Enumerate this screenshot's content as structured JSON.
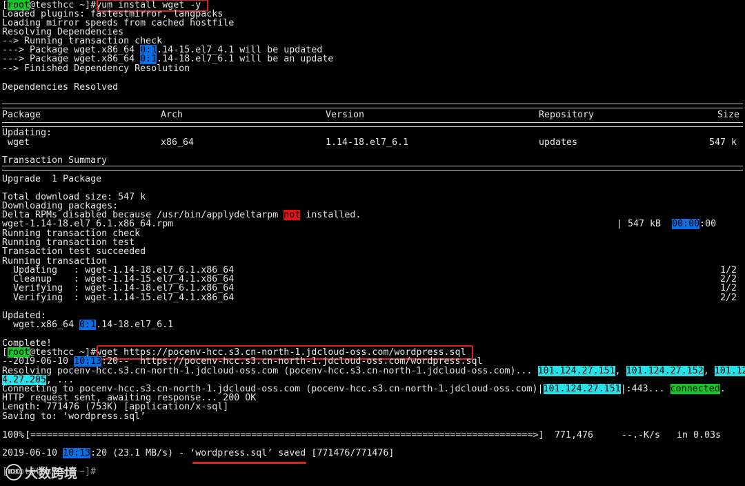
{
  "colors": {
    "prompt_highlight": "#18c428",
    "time_highlight": "#0a6fe6",
    "error_highlight": "#e01414",
    "ip_highlight": "#28e0e8",
    "annotation": "#e0241c"
  },
  "prompt": {
    "user": "root",
    "host": "@testhcc ~]#",
    "open": "["
  },
  "cmd1": "yum install wget -y",
  "lines1": [
    "Loaded plugins: fastestmirror, langpacks",
    "Loading mirror speeds from cached hostfile",
    "Resolving Dependencies",
    "--> Running transaction check"
  ],
  "pkg_line1": {
    "pre": "---> Package wget.x86_64 ",
    "hl": "0:1",
    "post": ".14-15.el7_4.1 will be updated"
  },
  "pkg_line2": {
    "pre": "---> Package wget.x86_64 ",
    "hl": "0:1",
    "post": ".14-18.el7_6.1 will be an update"
  },
  "finished": "--> Finished Dependency Resolution",
  "deps_resolved": "Dependencies Resolved",
  "table": {
    "headers": {
      "package": "Package",
      "arch": "Arch",
      "version": "Version",
      "repository": "Repository",
      "size": "Size"
    },
    "section": "Updating:",
    "row": {
      "package": " wget",
      "arch": "x86_64",
      "version": "1.14-18.el7_6.1",
      "repository": "updates",
      "size": "547 k"
    }
  },
  "transaction_summary": "Transaction Summary",
  "upgrade": "Upgrade  1 Package",
  "total_download": "Total download size: 547 k",
  "downloading": "Downloading packages:",
  "delta": {
    "pre": "Delta RPMs disabled because /usr/bin/applydeltarpm ",
    "hl": "not",
    "post": " installed."
  },
  "rpm_line": {
    "name": "wget-1.14-18.el7_6.1.x86_64.rpm",
    "size": "| 547 kB  ",
    "time_hl": "00:00",
    "time_post": ":00"
  },
  "txn_lines": [
    "Running transaction check",
    "Running transaction test",
    "Transaction test succeeded",
    "Running transaction"
  ],
  "txn_items": [
    {
      "action": "  Updating   : wget-1.14-18.el7_6.1.x86_64",
      "count": "1/2"
    },
    {
      "action": "  Cleanup    : wget-1.14-15.el7_4.1.x86_64",
      "count": "2/2"
    },
    {
      "action": "  Verifying  : wget-1.14-18.el7_6.1.x86_64",
      "count": "1/2"
    },
    {
      "action": "  Verifying  : wget-1.14-15.el7_4.1.x86_64",
      "count": "2/2"
    }
  ],
  "updated_label": "Updated:",
  "updated_line": {
    "pre": "  wget.x86_64 ",
    "hl": "0:1",
    "post": ".14-18.el7_6.1"
  },
  "complete": "Complete!",
  "cmd2": "wget https://pocenv-hcc.s3.cn-north-1.jdcloud-oss.com/wordpress.sql",
  "wget_start": {
    "pre": "--2019-06-10 ",
    "hl": "10:13",
    "post": ":20--  https://pocenv-hcc.s3.cn-north-1.jdcloud-oss.com/wordpress.sql"
  },
  "resolving": {
    "pre": "Resolving pocenv-hcc.s3.cn-north-1.jdcloud-oss.com (pocenv-hcc.s3.cn-north-1.jdcloud-oss.com)... ",
    "ip1": "101.124.27.151",
    "sep1": ", ",
    "ip2": "101.124.27.152",
    "sep2": ", ",
    "ip3a": "101.12"
  },
  "resolving_cont": {
    "hl": "4.27.205",
    "post": ", ..."
  },
  "connecting": {
    "pre": "Connecting to pocenv-hcc.s3.cn-north-1.jdcloud-oss.com (pocenv-hcc.s3.cn-north-1.jdcloud-oss.com)|",
    "ip": "101.124.27.151",
    "mid": "|:443... ",
    "status": "connected",
    "post": "."
  },
  "http_line": "HTTP request sent, awaiting response... 200 OK",
  "length_line": "Length: 771476 (753K) [application/x-sql]",
  "saving_line": "Saving to: ‘wordpress.sql’",
  "progress": {
    "percent": "100%",
    "bar": "[===========================================================================================>]",
    "bytes": " 771,476",
    "speed": "--.-K/s",
    "time": "in 0.03s",
    "fraction": 1.0
  },
  "saved_line": {
    "pre": "2019-06-10 ",
    "hl": "10:13",
    "mid": ":20 (23.1 MB/s) - ",
    "file": "‘wordpress.sql’ saved",
    "post": " [771476/771476]"
  },
  "last_prompt": "[root@testhcc ~]#",
  "watermark": {
    "logo_text": "IDC",
    "text": "大数跨境"
  }
}
